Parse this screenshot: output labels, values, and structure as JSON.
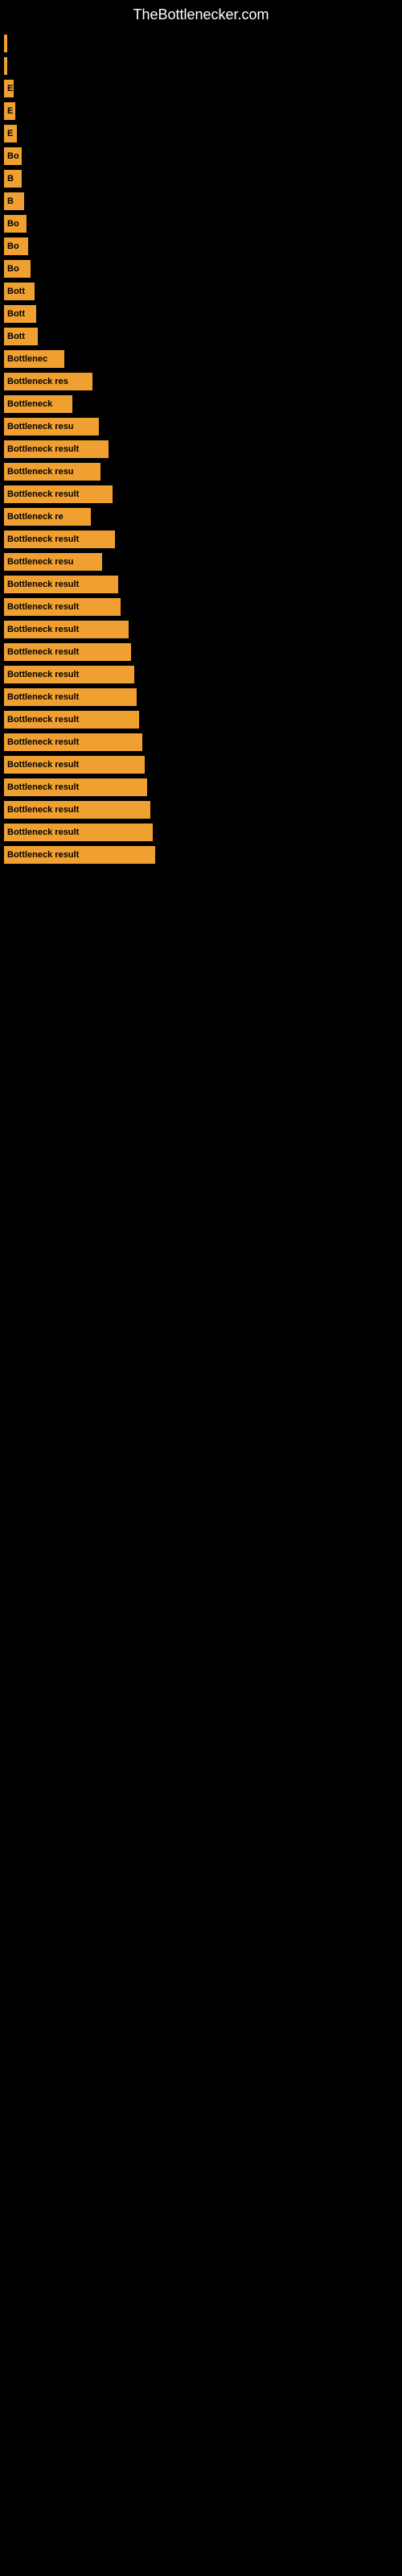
{
  "site": {
    "title": "TheBottlenecker.com"
  },
  "bars": [
    {
      "label": "",
      "width": 3
    },
    {
      "label": "",
      "width": 3
    },
    {
      "label": "E",
      "width": 12
    },
    {
      "label": "E",
      "width": 14
    },
    {
      "label": "E",
      "width": 16
    },
    {
      "label": "Bo",
      "width": 22
    },
    {
      "label": "B",
      "width": 22
    },
    {
      "label": "B",
      "width": 25
    },
    {
      "label": "Bo",
      "width": 28
    },
    {
      "label": "Bo",
      "width": 30
    },
    {
      "label": "Bo",
      "width": 33
    },
    {
      "label": "Bott",
      "width": 38
    },
    {
      "label": "Bott",
      "width": 40
    },
    {
      "label": "Bott",
      "width": 42
    },
    {
      "label": "Bottlenec",
      "width": 75
    },
    {
      "label": "Bottleneck res",
      "width": 110
    },
    {
      "label": "Bottleneck",
      "width": 85
    },
    {
      "label": "Bottleneck resu",
      "width": 118
    },
    {
      "label": "Bottleneck result",
      "width": 130
    },
    {
      "label": "Bottleneck resu",
      "width": 120
    },
    {
      "label": "Bottleneck result",
      "width": 135
    },
    {
      "label": "Bottleneck re",
      "width": 108
    },
    {
      "label": "Bottleneck result",
      "width": 138
    },
    {
      "label": "Bottleneck resu",
      "width": 122
    },
    {
      "label": "Bottleneck result",
      "width": 142
    },
    {
      "label": "Bottleneck result",
      "width": 145
    },
    {
      "label": "Bottleneck result",
      "width": 155
    },
    {
      "label": "Bottleneck result",
      "width": 158
    },
    {
      "label": "Bottleneck result",
      "width": 162
    },
    {
      "label": "Bottleneck result",
      "width": 165
    },
    {
      "label": "Bottleneck result",
      "width": 168
    },
    {
      "label": "Bottleneck result",
      "width": 172
    },
    {
      "label": "Bottleneck result",
      "width": 175
    },
    {
      "label": "Bottleneck result",
      "width": 178
    },
    {
      "label": "Bottleneck result",
      "width": 182
    },
    {
      "label": "Bottleneck result",
      "width": 185
    },
    {
      "label": "Bottleneck result",
      "width": 188
    }
  ]
}
